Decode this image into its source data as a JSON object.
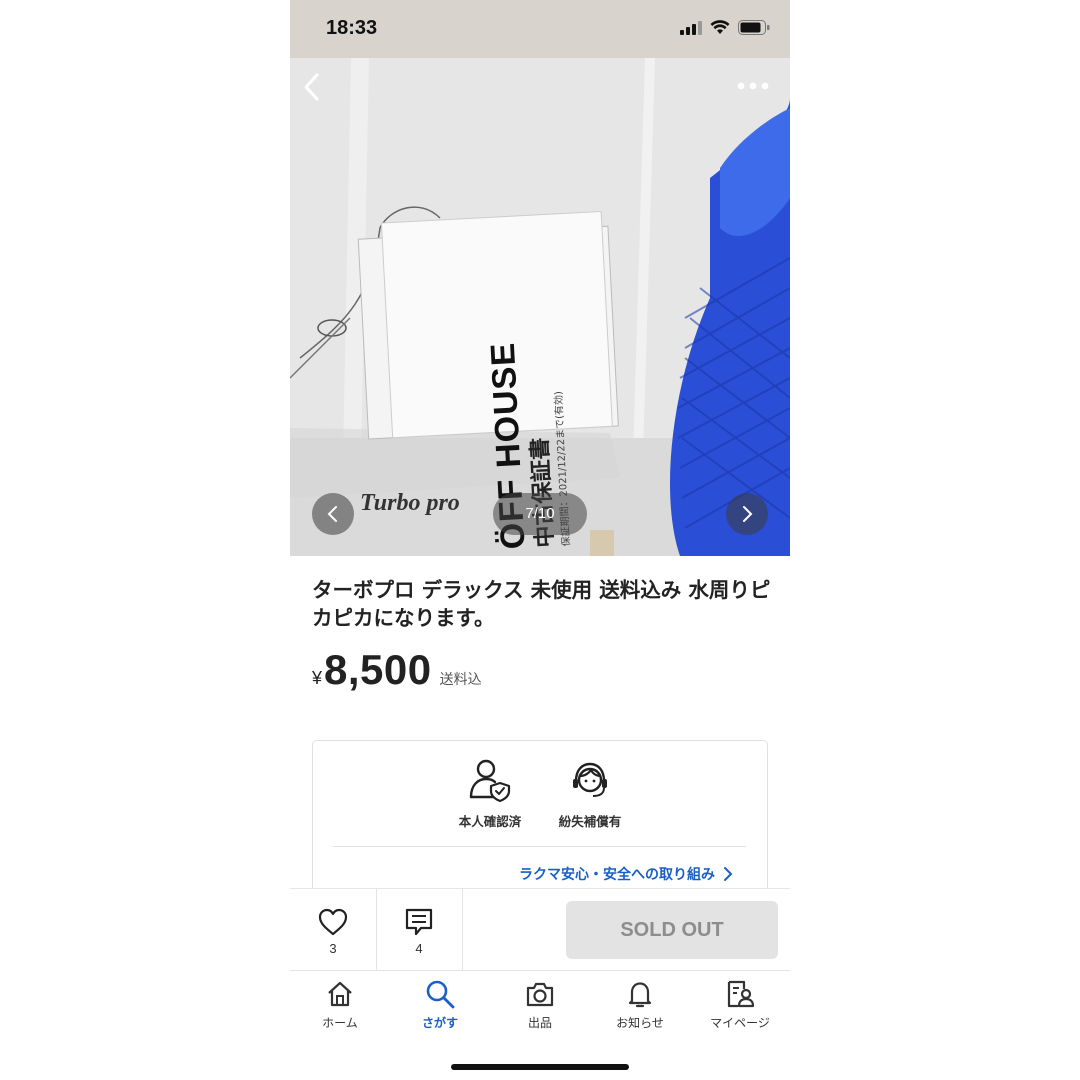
{
  "status_bar": {
    "time": "18:33"
  },
  "gallery": {
    "counter": "7/10"
  },
  "photo_text": {
    "brand": "ÖFF HOUSE",
    "doc_title": "中古保証書",
    "warranty": "保証期間：2021/12/22まで(有効)",
    "product_print": "Turbo pro"
  },
  "product": {
    "title": "ターボプロ デラックス 未使用 送料込み 水周りピカピカになります。",
    "currency": "¥",
    "price": "8,500",
    "shipping": "送料込"
  },
  "trust": {
    "items": [
      {
        "label": "本人確認済",
        "icon": "verified-user-icon"
      },
      {
        "label": "紛失補償有",
        "icon": "support-agent-icon"
      }
    ],
    "link": "ラクマ安心・安全への取り組み"
  },
  "actions": {
    "likes": "3",
    "comments": "4",
    "sold_out": "SOLD OUT"
  },
  "tabs": [
    {
      "label": "ホーム",
      "icon": "home-icon"
    },
    {
      "label": "さがす",
      "icon": "search-icon",
      "active": true
    },
    {
      "label": "出品",
      "icon": "camera-icon"
    },
    {
      "label": "お知らせ",
      "icon": "bell-icon"
    },
    {
      "label": "マイページ",
      "icon": "mypage-icon"
    }
  ],
  "colors": {
    "accent": "#1a5fc6",
    "sold_out_bg": "#e3e3e3"
  }
}
